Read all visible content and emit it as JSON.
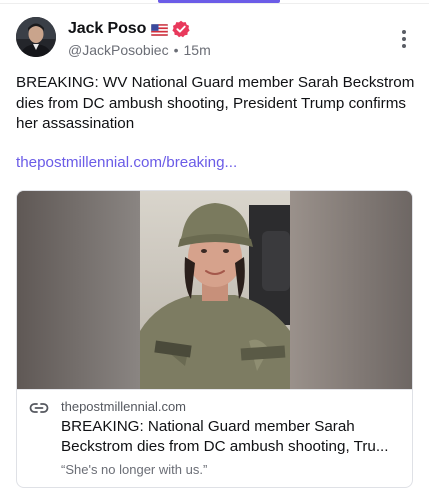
{
  "author": {
    "display_name": "Jack Poso",
    "flag_emoji": "US flag",
    "verified_icon": "verified-badge",
    "handle": "@JackPosobiec",
    "separator": "•",
    "time": "15m"
  },
  "post": {
    "text": "BREAKING: WV National Guard member Sarah Beckstrom dies from DC ambush shooting, President Trump confirms her assassination",
    "link_text": "thepostmillennial.com/breaking..."
  },
  "link_card": {
    "domain": "thepostmillennial.com",
    "title_line1": "BREAKING: National Guard member Sarah",
    "title_line2": "Beckstrom dies from DC ambush shooting, Tru...",
    "description": "“She's no longer with us.”",
    "image_labels": {
      "left_tape": "U.S. ARMY",
      "right_tape": "BECKSTROM"
    }
  },
  "menu_icon": "more-vertical-icon",
  "colors": {
    "accent": "#6b5ce7",
    "verified": "#e8395c",
    "text_primary": "#101114",
    "text_secondary": "#6b6e76"
  }
}
